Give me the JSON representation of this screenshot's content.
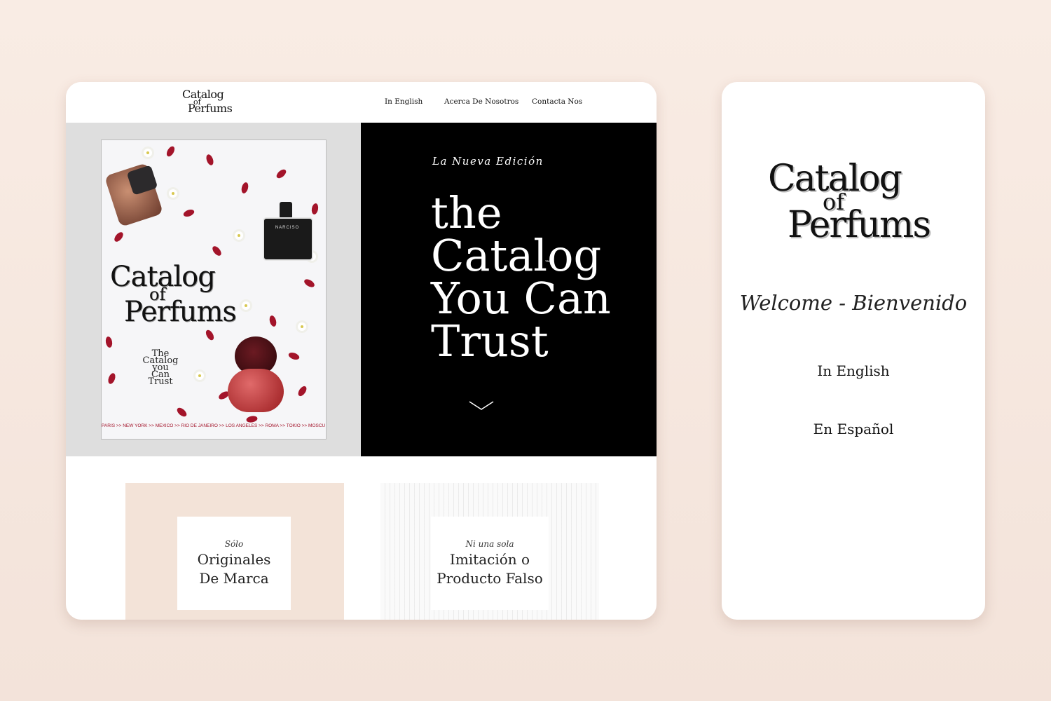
{
  "colors": {
    "background": "#f7e8df",
    "hero_black": "#000000",
    "hero_gray": "#dedede",
    "feature_peach": "#f3e3d8",
    "petal_red": "#a3142a"
  },
  "desktop": {
    "header": {
      "logo": {
        "line1": "Catalog",
        "line2": "of",
        "line3": "Perfums"
      },
      "nav": [
        "In English",
        "Acerca De Nosotros",
        "Contacta Nos"
      ]
    },
    "poster": {
      "logo": {
        "line1": "Catalog",
        "line2": "of",
        "line3": "Perfums"
      },
      "tagline": [
        "The",
        "Catalog",
        "you",
        "Can Trust"
      ],
      "bottle_label": "NARCISO",
      "cities": "PARIS >> NEW YORK >> MEXICO >> RIO DE JANEIRO >> LOS ANGELES >> ROMA >> TOKIO >> MOSCU"
    },
    "hero": {
      "kicker": "La Nueva Edición",
      "headline": [
        "the",
        "Catalog",
        "You Can",
        "Trust"
      ],
      "trademark": "™",
      "scroll_icon": "chevron-down-icon"
    },
    "features": [
      {
        "small": "Sólo",
        "big": [
          "Originales",
          "De Marca"
        ]
      },
      {
        "small": "Ni una sola",
        "big": [
          "Imitación o",
          "Producto Falso"
        ]
      }
    ]
  },
  "mobile": {
    "logo": {
      "line1": "Catalog",
      "line2": "of",
      "line3": "Perfums"
    },
    "welcome": "Welcome - Bienvenido",
    "links": [
      "In English",
      "En Español"
    ]
  }
}
